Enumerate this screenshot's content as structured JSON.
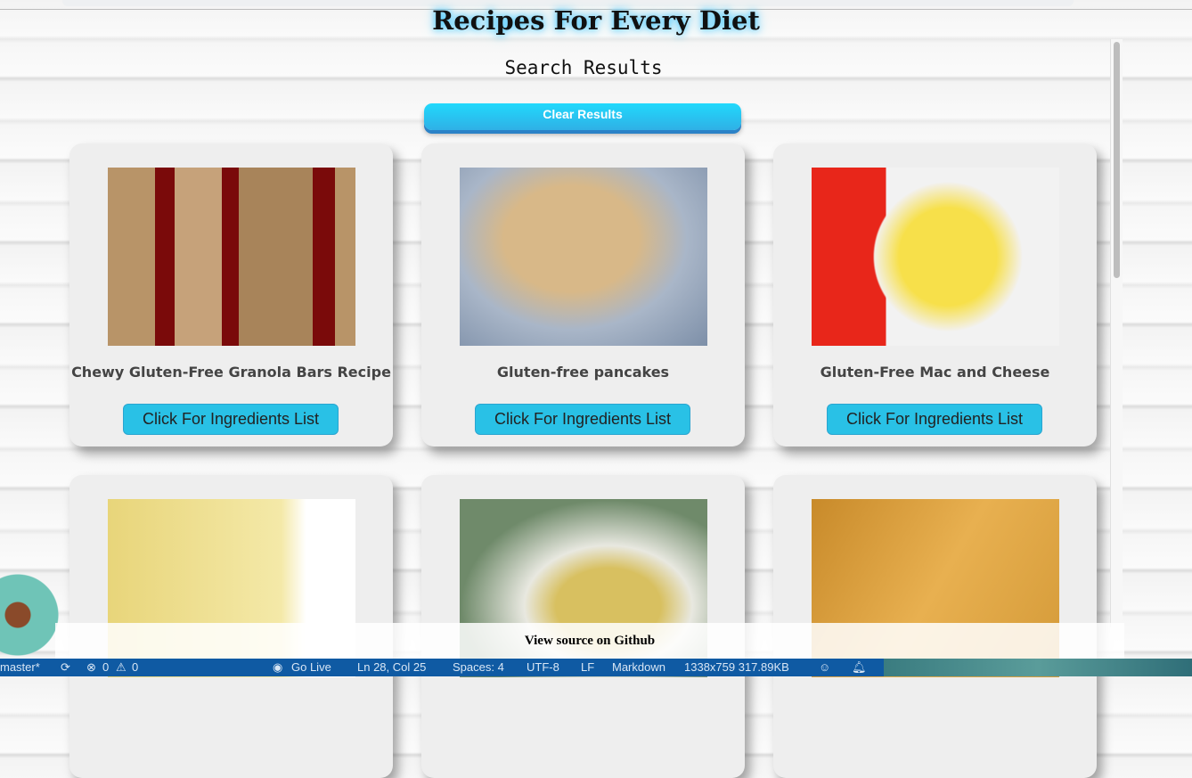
{
  "header": {
    "title": "Recipes For Every Diet",
    "subtitle": "Search Results",
    "clear_label": "Clear Results"
  },
  "recipes": [
    {
      "title": "Chewy Gluten-Free Granola Bars Recipe",
      "button": "Click For Ingredients List"
    },
    {
      "title": "Gluten-free pancakes",
      "button": "Click For Ingredients List"
    },
    {
      "title": "Gluten-Free Mac and Cheese",
      "button": "Click For Ingredients List"
    },
    {
      "title": "",
      "button": ""
    },
    {
      "title": "",
      "button": ""
    },
    {
      "title": "",
      "button": ""
    }
  ],
  "footer": {
    "link": "View source on Github"
  },
  "statusbar": {
    "branch": "master*",
    "errors": "0",
    "warnings": "0",
    "golive": "Go Live",
    "position": "Ln 28, Col 25",
    "spaces": "Spaces: 4",
    "encoding": "UTF-8",
    "eol": "LF",
    "language": "Markdown",
    "image_info": "1338x759 317.89KB"
  }
}
